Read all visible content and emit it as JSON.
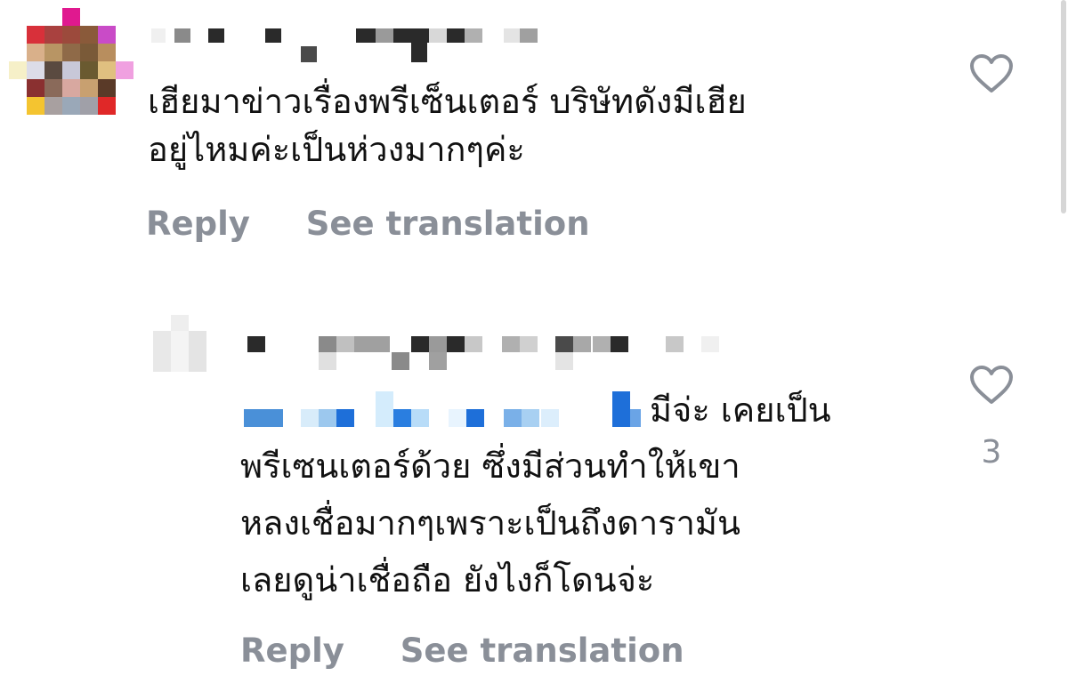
{
  "comments": [
    {
      "text_lines": [
        "เฮียมาข่าวเรื่องพรีเซ็นเตอร์ บริษัทดังมีเฮีย",
        "อยู่ไหมค่ะเป็นห่วงมากๆค่ะ"
      ],
      "reply_label": "Reply",
      "translate_label": "See translation"
    },
    {
      "text_lines": [
        "มีจ่ะ เคยเป็น",
        "พรีเซนเตอร์ด้วย ซึ่งมีส่วนทำให้เขา",
        "หลงเชื่อมากๆเพราะเป็นถึงดารามัน",
        "เลยดูน่าเชื่อถือ ยังไงก็โดนจ่ะ"
      ],
      "like_count": "3",
      "reply_label": "Reply",
      "translate_label": "See translation"
    }
  ],
  "icons": {
    "like": "heart-outline-icon"
  },
  "colors": {
    "text": "#111111",
    "muted": "#8a8f98",
    "mention_blue": "#1e6fd9"
  }
}
